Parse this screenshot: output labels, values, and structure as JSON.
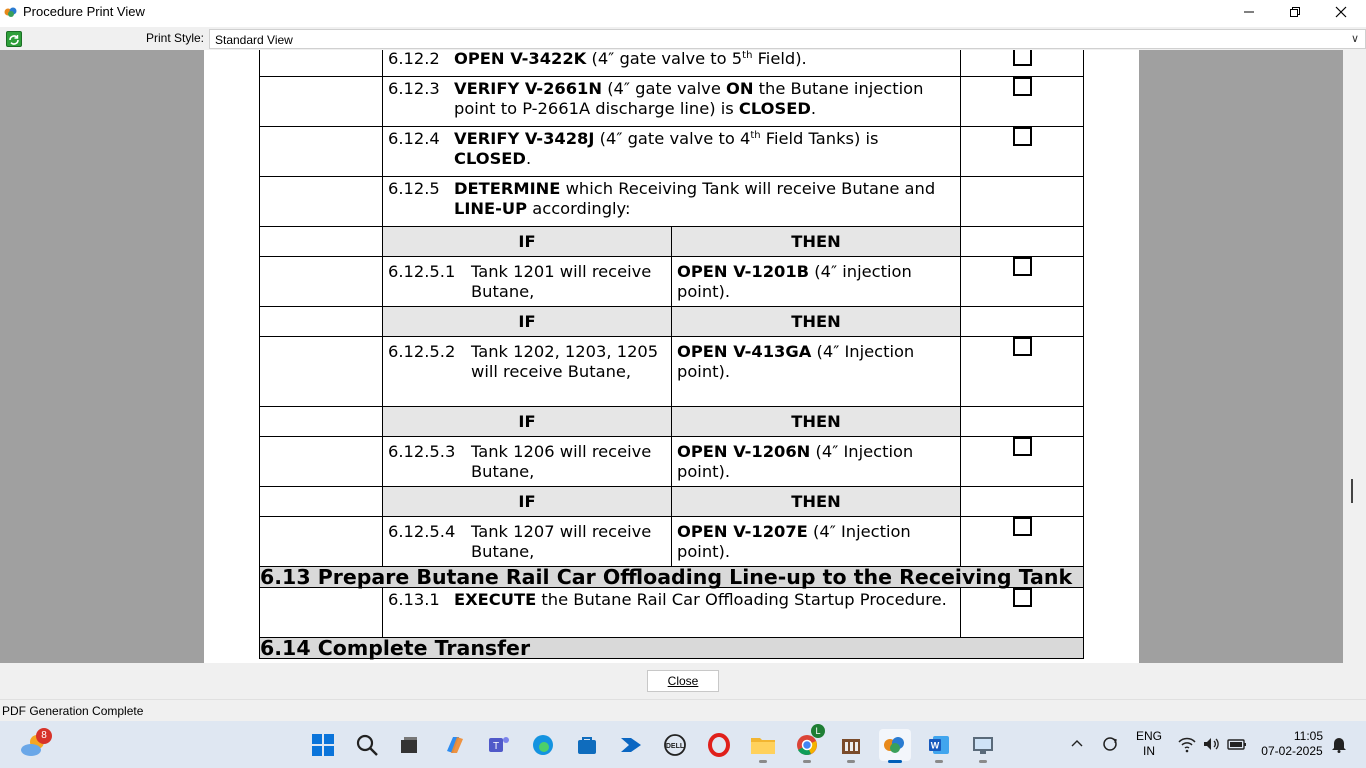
{
  "window": {
    "title": "Procedure Print View",
    "controls": {
      "minimize": "—",
      "maximize": "❐",
      "close": "✕"
    }
  },
  "toolbar": {
    "print_style_label": "Print Style:",
    "print_style_value": "Standard View"
  },
  "procedure": {
    "steps_top": [
      {
        "num": "6.12.2",
        "html": "<b>OPEN V-3422K</b> (4″ gate valve to 5<sup>th</sup> Field).",
        "checkbox": true
      },
      {
        "num": "6.12.3",
        "html": "<b>VERIFY V-2661N</b> (4″ gate valve <b>ON</b> the Butane injection point to P-2661A discharge line) is <b>CLOSED</b>.",
        "checkbox": true
      },
      {
        "num": "6.12.4",
        "html": "<b>VERIFY V-3428J</b> (4″ gate valve to 4<sup>th</sup> Field Tanks) is <b>CLOSED</b>.",
        "checkbox": true
      },
      {
        "num": "6.12.5",
        "html": "<b>DETERMINE</b> which Receiving Tank will receive Butane and <b>LINE-UP</b> accordingly:",
        "checkbox": false
      }
    ],
    "if_label": "IF",
    "then_label": "THEN",
    "conditions": [
      {
        "num": "6.12.5.1",
        "if_text": "Tank 1201 will receive Butane,",
        "then_html": "<b>OPEN V-1201B</b> (4″ injection point)."
      },
      {
        "num": "6.12.5.2",
        "if_text": "Tank 1202, 1203, 1205 will receive Butane,",
        "then_html": "<b>OPEN V-413GA</b> (4″ Injection point)."
      },
      {
        "num": "6.12.5.3",
        "if_text": "Tank 1206 will receive Butane,",
        "then_html": "<b>OPEN V-1206N</b> (4″ Injection point)."
      },
      {
        "num": "6.12.5.4",
        "if_text": "Tank 1207 will receive Butane,",
        "then_html": "<b>OPEN V-1207E</b> (4″ Injection point)."
      }
    ],
    "section_613_title": "6.13 Prepare Butane Rail Car Offloading Line-up to the Receiving Tank",
    "step_6131": {
      "num": "6.13.1",
      "html": "<b>EXECUTE</b> the Butane Rail Car Offloading Startup Procedure."
    },
    "section_614_partial": "6.14 Complete Transfer"
  },
  "close_button": "Close",
  "status": "PDF Generation Complete",
  "taskbar": {
    "weather_badge": "8",
    "chrome_badge": "L",
    "tray_lang_1": "ENG",
    "tray_lang_2": "IN",
    "time": "11:05",
    "date": "07-02-2025"
  },
  "colors": {
    "viewer_bg": "#a0a0a0",
    "shaded_row": "#e6e6e6",
    "section_row": "#d9d9d9",
    "taskbar": "#dfe7f2"
  }
}
